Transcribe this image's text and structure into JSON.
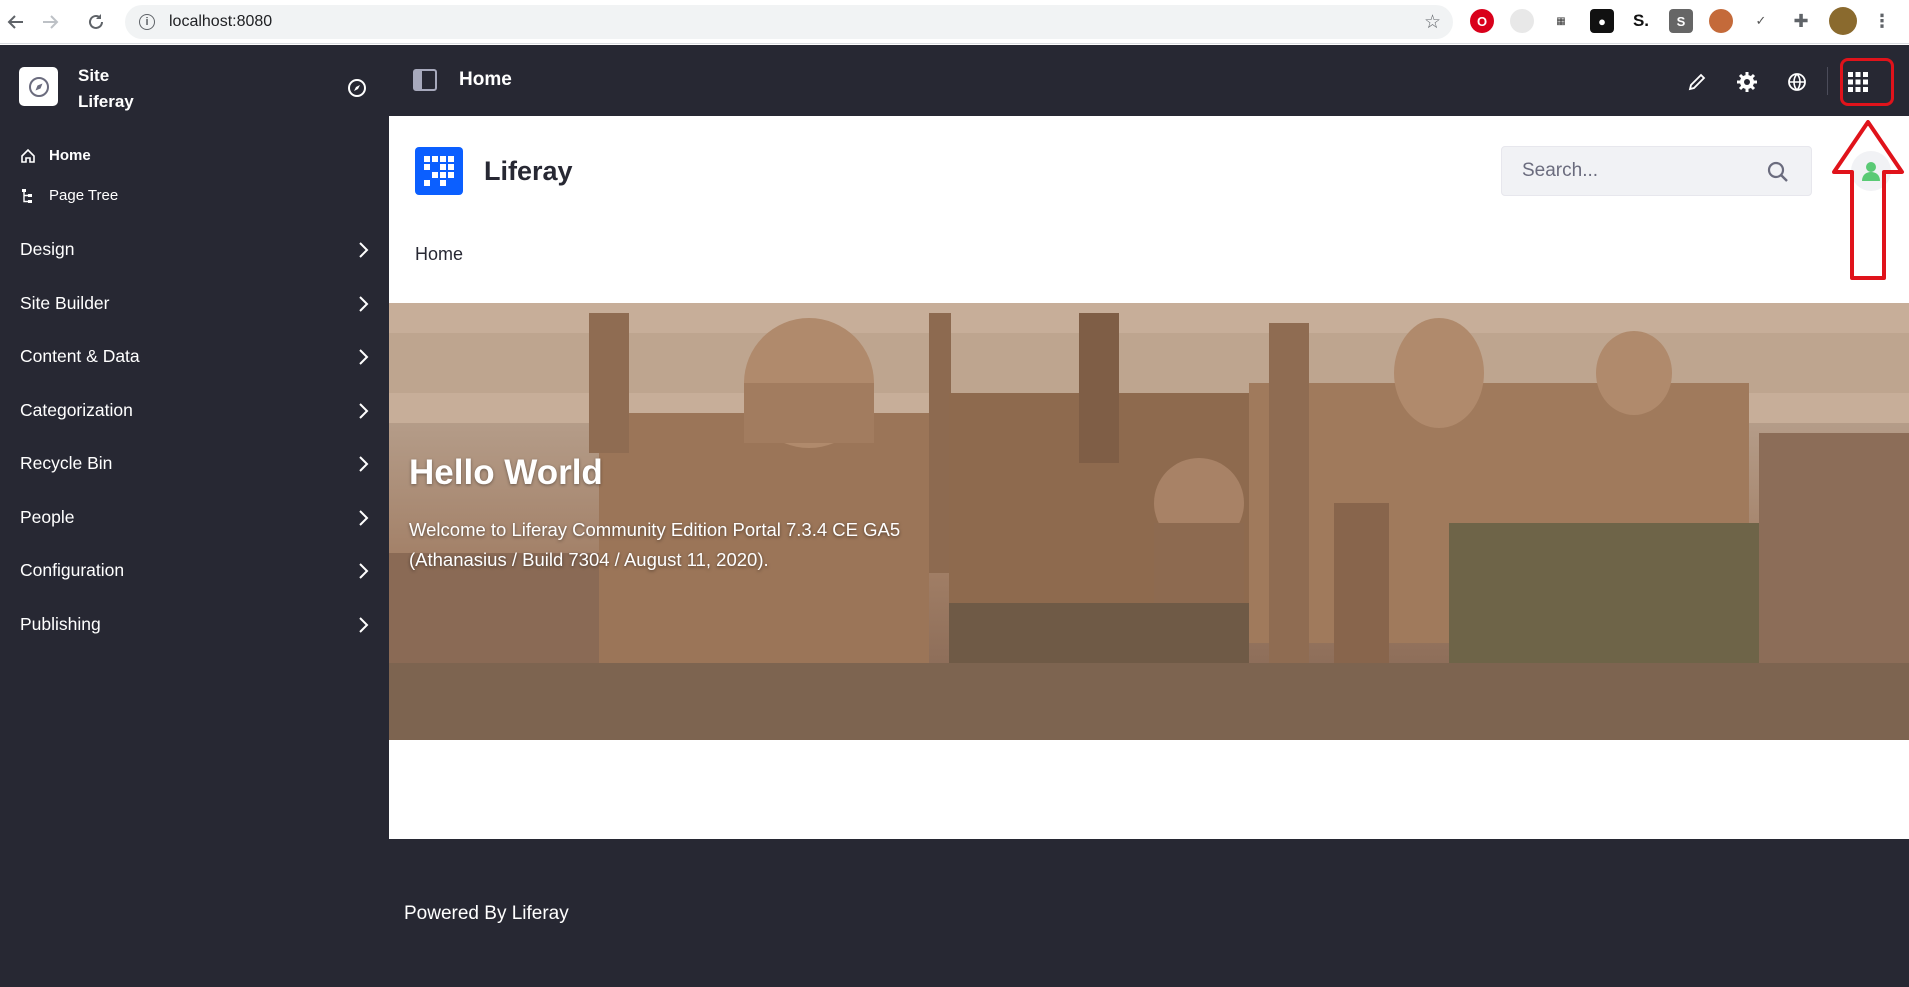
{
  "browser": {
    "url": "localhost:8080"
  },
  "sidebar": {
    "site_line1": "Site",
    "site_line2": "Liferay",
    "links": [
      {
        "label": "Home"
      },
      {
        "label": "Page Tree"
      }
    ],
    "categories": [
      {
        "label": "Design"
      },
      {
        "label": "Site Builder"
      },
      {
        "label": "Content & Data"
      },
      {
        "label": "Categorization"
      },
      {
        "label": "Recycle Bin"
      },
      {
        "label": "People"
      },
      {
        "label": "Configuration"
      },
      {
        "label": "Publishing"
      }
    ]
  },
  "control_menu": {
    "title": "Home"
  },
  "page": {
    "brand_name": "Liferay",
    "search_placeholder": "Search...",
    "breadcrumb": "Home",
    "hero_title": "Hello World",
    "hero_text": "Welcome to Liferay Community Edition Portal 7.3.4 CE GA5 (Athanasius / Build 7304 / August 11, 2020).",
    "footer_text": "Powered By Liferay"
  },
  "colors": {
    "sidebar_bg": "#272833",
    "brand_blue": "#0b5fff",
    "annotation_red": "#e0131b"
  }
}
